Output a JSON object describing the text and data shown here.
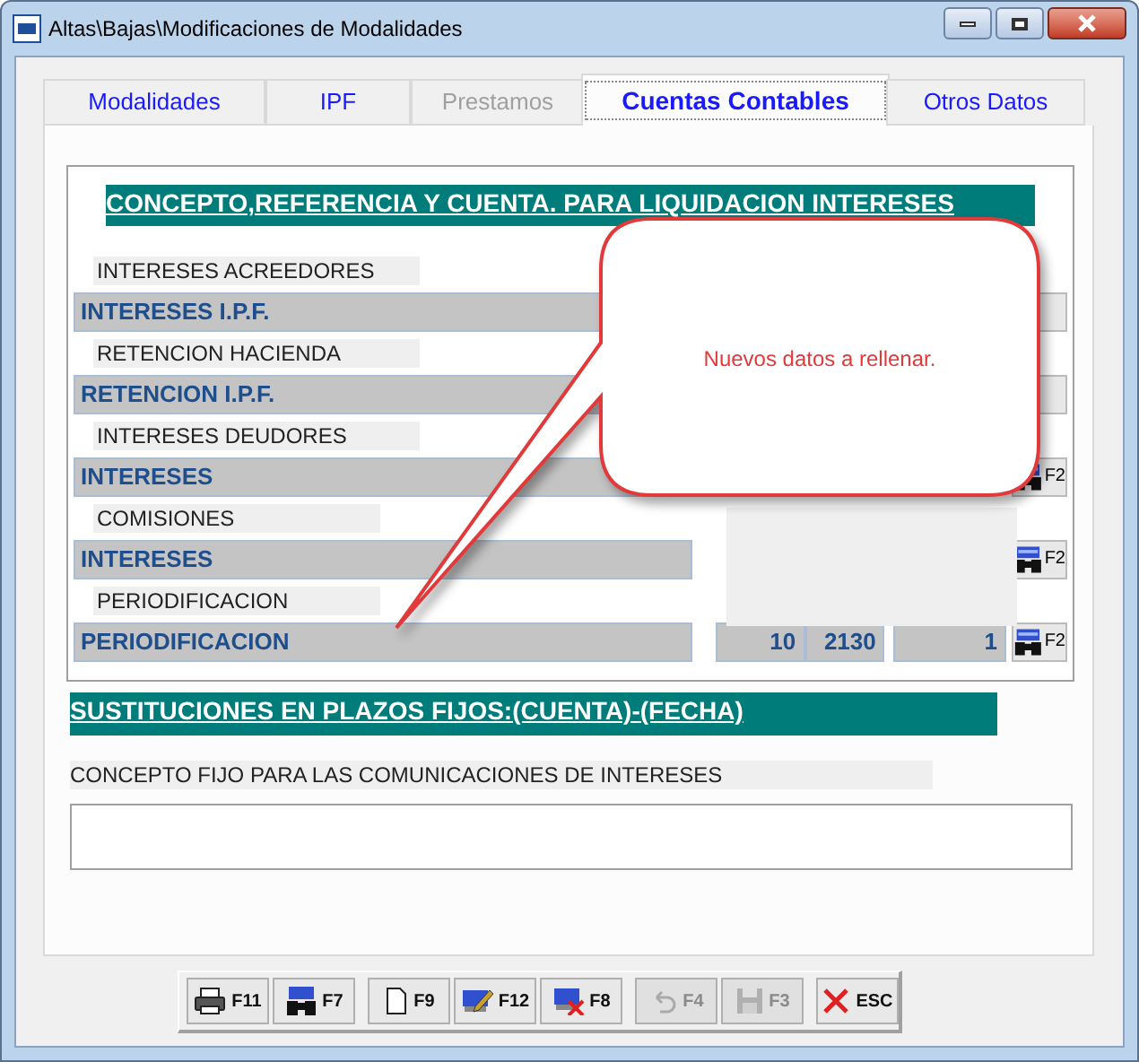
{
  "window": {
    "title": "Altas\\Bajas\\Modificaciones de Modalidades"
  },
  "tabs": [
    {
      "label": "Modalidades",
      "selected": false,
      "disabled": false
    },
    {
      "label": "IPF",
      "selected": false,
      "disabled": false
    },
    {
      "label": "Prestamos",
      "selected": false,
      "disabled": true
    },
    {
      "label": "Cuentas Contables",
      "selected": true,
      "disabled": false
    },
    {
      "label": "Otros Datos",
      "selected": false,
      "disabled": false
    }
  ],
  "section_title": "CONCEPTO,REFERENCIA Y CUENTA. PARA LIQUIDACION INTERESES",
  "rows": [
    {
      "label": "INTERESES ACREEDORES",
      "account": "INTERESES I.P.F."
    },
    {
      "label": "RETENCION HACIENDA",
      "account": "RETENCION I.P.F."
    },
    {
      "label": "INTERESES DEUDORES",
      "account": "INTERESES",
      "button": "F2"
    },
    {
      "label": "COMISIONES",
      "account": "INTERESES",
      "button": "F2"
    },
    {
      "label": "PERIODIFICACION",
      "account": "PERIODIFICACION",
      "code_1": "10",
      "code_2": "2130",
      "code_3": "1",
      "button": "F2"
    }
  ],
  "callout": {
    "text": "Nuevos datos a rellenar."
  },
  "substitutions_title": "SUSTITUCIONES EN PLAZOS FIJOS:(CUENTA)-(FECHA)",
  "concept_label": "CONCEPTO FIJO PARA LAS COMUNICACIONES DE INTERESES",
  "toolbar": [
    {
      "kind": "print",
      "label": "F11",
      "disabled": false
    },
    {
      "kind": "find",
      "label": "F7",
      "disabled": false
    },
    {
      "kind": "new",
      "label": "F9",
      "disabled": false
    },
    {
      "kind": "edit",
      "label": "F12",
      "disabled": false
    },
    {
      "kind": "delete",
      "label": "F8",
      "disabled": false
    },
    {
      "kind": "undo",
      "label": "F4",
      "disabled": true
    },
    {
      "kind": "save",
      "label": "F3",
      "disabled": true
    },
    {
      "kind": "close",
      "label": "ESC",
      "disabled": false
    }
  ]
}
